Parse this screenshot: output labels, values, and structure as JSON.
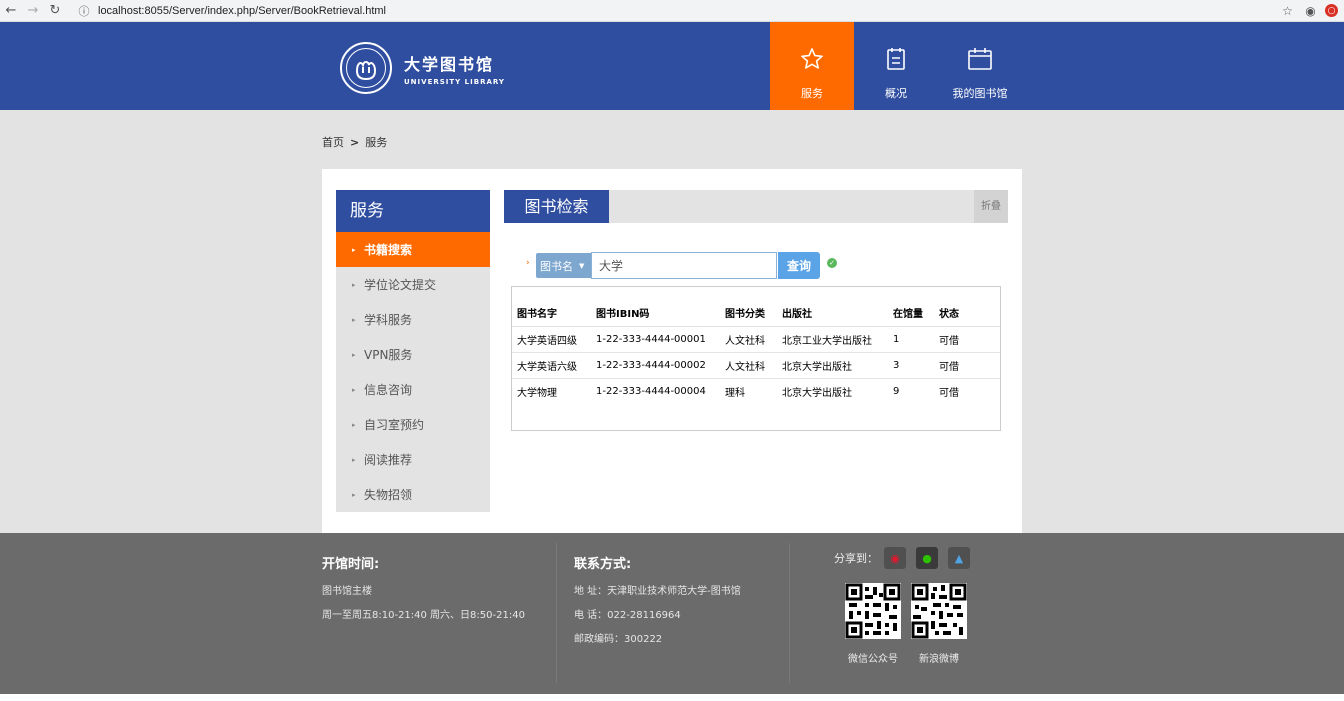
{
  "browser": {
    "url": "localhost:8055/Server/index.php/Server/BookRetrieval.html"
  },
  "header": {
    "logo_cn": "大学图书馆",
    "logo_en": "UNIVERSITY LIBRARY",
    "nav": [
      {
        "label": "服务",
        "icon": "star-icon"
      },
      {
        "label": "概况",
        "icon": "document-icon"
      },
      {
        "label": "我的图书馆",
        "icon": "calendar-icon"
      }
    ]
  },
  "breadcrumb": {
    "home": "首页",
    "sep": ">",
    "current": "服务"
  },
  "sidebar": {
    "title": "服务",
    "items": [
      {
        "label": "书籍搜索",
        "active": true
      },
      {
        "label": "学位论文提交"
      },
      {
        "label": "学科服务"
      },
      {
        "label": "VPN服务"
      },
      {
        "label": "信息咨询"
      },
      {
        "label": "自习室预约"
      },
      {
        "label": "阅读推荐"
      },
      {
        "label": "失物招领"
      }
    ]
  },
  "content": {
    "title": "图书检索",
    "fold_label": "折叠",
    "search": {
      "select_value": "图书名",
      "input_value": "大学",
      "button_label": "查询"
    },
    "table": {
      "headers": [
        "图书名字",
        "图书IBIN码",
        "图书分类",
        "出版社",
        "在馆量",
        "状态"
      ],
      "rows": [
        [
          "大学英语四级",
          "1-22-333-4444-00001",
          "人文社科",
          "北京工业大学出版社",
          "1",
          "可借"
        ],
        [
          "大学英语六级",
          "1-22-333-4444-00002",
          "人文社科",
          "北京大学出版社",
          "3",
          "可借"
        ],
        [
          "大学物理",
          "1-22-333-4444-00004",
          "理科",
          "北京大学出版社",
          "9",
          "可借"
        ]
      ]
    }
  },
  "footer": {
    "hours_title": "开馆时间:",
    "hours_line1": "图书馆主楼",
    "hours_line2": "周一至周五8:10-21:40 周六、日8:50-21:40",
    "contact_title": "联系方式:",
    "address": "地 址：天津职业技术师范大学-图书馆",
    "phone": "电 话：022-28116964",
    "postcode": "邮政编码：300222",
    "share_label": "分享到：",
    "qr1_label": "微信公众号",
    "qr2_label": "新浪微博"
  },
  "colors": {
    "brand_blue": "#2f4ea0",
    "accent_orange": "#ff6a00",
    "footer_grey": "#6b6b6b"
  }
}
